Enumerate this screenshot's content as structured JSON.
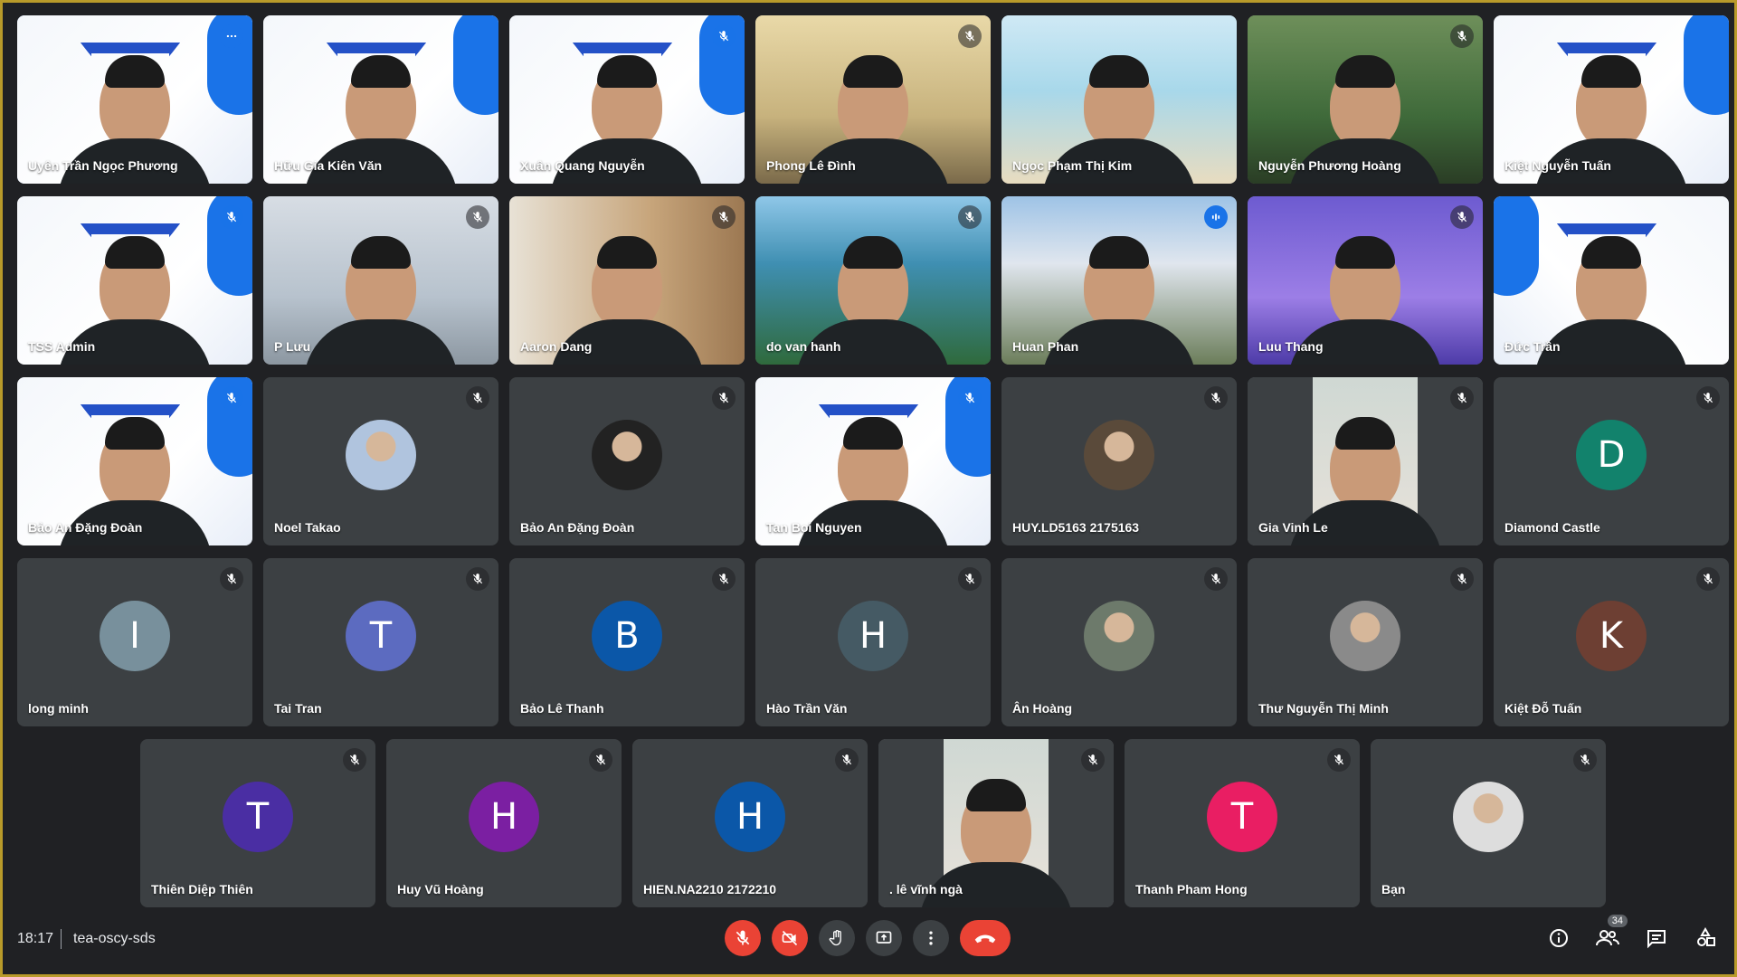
{
  "participants": [
    {
      "name": "Uyên Trần Ngọc Phương",
      "initial": "",
      "avatar_color": "",
      "style": "logo-video",
      "mic": "more",
      "active": true
    },
    {
      "name": "Hữu Gia Kiên Văn",
      "initial": "",
      "avatar_color": "",
      "style": "logo-video",
      "mic": "none"
    },
    {
      "name": "Xuân Quang Nguyễn",
      "initial": "",
      "avatar_color": "",
      "style": "logo-video",
      "mic": "muted-blue"
    },
    {
      "name": "Phong Lê Đình",
      "initial": "",
      "avatar_color": "",
      "style": "video-bright",
      "mic": "muted-dark"
    },
    {
      "name": "Ngọc Phạm Thị Kim",
      "initial": "",
      "avatar_color": "",
      "style": "video-beach",
      "mic": "none"
    },
    {
      "name": "Nguyễn Phương Hoàng",
      "initial": "",
      "avatar_color": "",
      "style": "video-forest",
      "mic": "muted-dark"
    },
    {
      "name": "Kiệt Nguyễn Tuấn",
      "initial": "",
      "avatar_color": "",
      "style": "logo-video",
      "mic": "none"
    },
    {
      "name": "TSS Admin",
      "initial": "",
      "avatar_color": "",
      "style": "logo-video",
      "mic": "muted-blue"
    },
    {
      "name": "P Lưu",
      "initial": "",
      "avatar_color": "",
      "style": "video-room",
      "mic": "muted-dark"
    },
    {
      "name": "Aaron Dang",
      "initial": "",
      "avatar_color": "",
      "style": "video-kitchen",
      "mic": "muted-dark"
    },
    {
      "name": "do van hanh",
      "initial": "",
      "avatar_color": "",
      "style": "video-beach2",
      "mic": "muted-dark"
    },
    {
      "name": "Huan Phan",
      "initial": "",
      "avatar_color": "",
      "style": "video-mountain",
      "mic": "speaking"
    },
    {
      "name": "Luu Thang",
      "initial": "",
      "avatar_color": "",
      "style": "video-purple",
      "mic": "muted-dark"
    },
    {
      "name": "Đức Trần",
      "initial": "",
      "avatar_color": "",
      "style": "logo-video-mirror",
      "mic": "none"
    },
    {
      "name": "Bảo An Đặng Đoàn",
      "initial": "",
      "avatar_color": "",
      "style": "logo-video",
      "mic": "muted-blue"
    },
    {
      "name": "Noel Takao",
      "initial": "",
      "avatar_color": "#b0c4de",
      "style": "avatar-photo",
      "mic": "muted-dark"
    },
    {
      "name": "Bảo An Đặng Đoàn",
      "initial": "",
      "avatar_color": "#222",
      "style": "avatar-photo",
      "mic": "muted-dark"
    },
    {
      "name": "Tan Boi Nguyen",
      "initial": "",
      "avatar_color": "",
      "style": "logo-video",
      "mic": "muted-blue"
    },
    {
      "name": "HUY.LD5163 2175163",
      "initial": "",
      "avatar_color": "#5a4a3a",
      "style": "avatar-photo",
      "mic": "muted-dark"
    },
    {
      "name": "Gia Vinh Le",
      "initial": "",
      "avatar_color": "",
      "style": "video-pip",
      "mic": "muted-dark"
    },
    {
      "name": "Diamond Castle",
      "initial": "D",
      "avatar_color": "#12826c",
      "style": "avatar",
      "mic": "muted-dark"
    },
    {
      "name": "long minh",
      "initial": "I",
      "avatar_color": "#78909c",
      "style": "avatar",
      "mic": "muted-dark"
    },
    {
      "name": "Tai Tran",
      "initial": "T",
      "avatar_color": "#5c6bc0",
      "style": "avatar",
      "mic": "muted-dark"
    },
    {
      "name": "Bảo Lê Thanh",
      "initial": "B",
      "avatar_color": "#0b57a8",
      "style": "avatar",
      "mic": "muted-dark"
    },
    {
      "name": "Hào Trần Văn",
      "initial": "H",
      "avatar_color": "#455a64",
      "style": "avatar",
      "mic": "muted-dark"
    },
    {
      "name": "Ân Hoàng",
      "initial": "",
      "avatar_color": "#6d7a6b",
      "style": "avatar-photo",
      "mic": "muted-dark"
    },
    {
      "name": "Thư Nguyễn Thị Minh",
      "initial": "",
      "avatar_color": "#8a8a8a",
      "style": "avatar-photo",
      "mic": "muted-dark"
    },
    {
      "name": "Kiệt Đỗ Tuấn",
      "initial": "K",
      "avatar_color": "#6d3f33",
      "style": "avatar",
      "mic": "muted-dark"
    },
    {
      "name": "Thiên Diệp Thiên",
      "initial": "T",
      "avatar_color": "#4a2ea3",
      "style": "avatar",
      "mic": "muted-dark"
    },
    {
      "name": "Huy Vũ Hoàng",
      "initial": "H",
      "avatar_color": "#7b1fa2",
      "style": "avatar",
      "mic": "muted-dark"
    },
    {
      "name": "HIEN.NA2210 2172210",
      "initial": "H",
      "avatar_color": "#0b57a8",
      "style": "avatar",
      "mic": "muted-dark"
    },
    {
      "name": ". lê vĩnh ngà",
      "initial": "",
      "avatar_color": "",
      "style": "video-pip",
      "mic": "muted-dark"
    },
    {
      "name": "Thanh Pham Hong",
      "initial": "T",
      "avatar_color": "#e91e63",
      "style": "avatar",
      "mic": "muted-dark"
    },
    {
      "name": "Bạn",
      "initial": "",
      "avatar_color": "#ddd",
      "style": "avatar-photo",
      "mic": "muted-dark"
    }
  ],
  "bottom_bar": {
    "time": "18:17",
    "meeting_code": "tea-oscy-sds",
    "participants_count": "34"
  },
  "controls": [
    {
      "icon": "mic-off-icon",
      "red": true
    },
    {
      "icon": "camera-off-icon",
      "red": true
    },
    {
      "icon": "raise-hand-icon",
      "red": false
    },
    {
      "icon": "present-screen-icon",
      "red": false
    },
    {
      "icon": "more-options-icon",
      "red": false
    },
    {
      "icon": "end-call-icon",
      "red": true
    }
  ],
  "colors": {
    "background": "#202124",
    "tile": "#3c4043",
    "accent": "#1a73e8",
    "danger": "#ea4335"
  }
}
